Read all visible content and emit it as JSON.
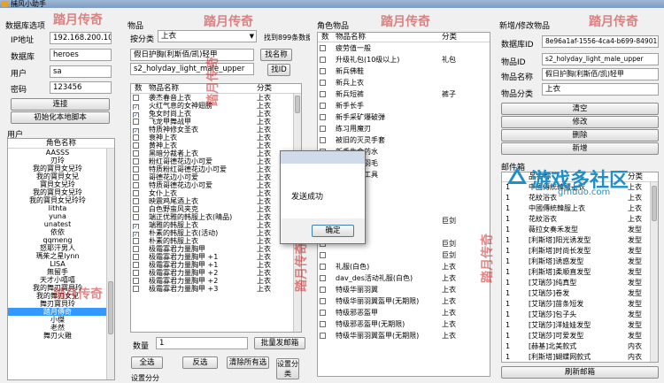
{
  "window": {
    "title": "捕风小助手"
  },
  "db": {
    "group_title": "数据库选项",
    "ip_label": "IP地址",
    "ip_value": "192.168.200.100",
    "db_label": "数据库",
    "db_value": "heroes",
    "user_label": "用户",
    "user_value": "sa",
    "pwd_label": "密码",
    "pwd_value": "123456",
    "connect_button": "连接",
    "init_button": "初始化本地脚本"
  },
  "users": {
    "group_title": "用户",
    "header": "角色名称",
    "items": [
      "AASSS",
      "刃玲",
      "我的寶貝女兒玲",
      "我的寶貝女兒",
      "寶貝女兒玲",
      "我的寶貝女兒玲",
      "我的寶貝女兒玲玲",
      "lithta",
      "yuna",
      "unatest",
      "依依",
      "qqmeng",
      "怒耶汗男人",
      "瑪茱之星lynn",
      "LISA",
      "無留手",
      "天才小嘻嘻",
      "我的舞刃寶貝玲",
      "我的舞刃女兒",
      "舞刃寶貝玲",
      "踏月傳奇",
      "小傑",
      "老然",
      "舞刃火雞"
    ],
    "selected_index": 20
  },
  "items_panel": {
    "group_title": "物品",
    "category_label": "按分类",
    "category_value": "上衣",
    "found_text": "找到899条数据",
    "search_value": "假日护胸(利斯佰/凯)轻甲",
    "search_name_button": "找名称",
    "code_value": "s2_holyday_light_male_upper",
    "search_id_button": "找ID",
    "col_num": "数",
    "col_name": "物品名称",
    "col_cat": "分类",
    "rows": [
      {
        "name": "袭杰春音上衣",
        "cat": "上衣",
        "checked": false
      },
      {
        "name": "火红气息的女神翅膀",
        "cat": "上衣",
        "checked": true
      },
      {
        "name": "兔女时尚上衣",
        "cat": "上衣",
        "checked": true
      },
      {
        "name": "飞龙甲舞战甲",
        "cat": "上衣",
        "checked": false
      },
      {
        "name": "特质神修女圣衣",
        "cat": "上衣",
        "checked": true
      },
      {
        "name": "衰神上衣",
        "cat": "上衣",
        "checked": false
      },
      {
        "name": "黄神上衣",
        "cat": "上衣",
        "checked": false
      },
      {
        "name": "黑暗分裁者上衣",
        "cat": "上衣",
        "checked": false
      },
      {
        "name": "粉红哥德花边小可爱",
        "cat": "上衣",
        "checked": false
      },
      {
        "name": "特质粉红哥德花边小可爱",
        "cat": "上衣",
        "checked": false
      },
      {
        "name": "哥德花边小可爱",
        "cat": "上衣",
        "checked": false
      },
      {
        "name": "特质哥德花边小可爱",
        "cat": "上衣",
        "checked": false
      },
      {
        "name": "女仆上衣",
        "cat": "上衣",
        "checked": false
      },
      {
        "name": "映震鸡尾酒上衣",
        "cat": "上衣",
        "checked": false
      },
      {
        "name": "白色野蛮风夹克",
        "cat": "上衣",
        "checked": false
      },
      {
        "name": "端正优雅的韩服上衣(晴品)",
        "cat": "上衣",
        "checked": false
      },
      {
        "name": "端雅的韩服上衣",
        "cat": "上衣",
        "checked": true
      },
      {
        "name": "朴素的韩服上衣(活动)",
        "cat": "上衣",
        "checked": true
      },
      {
        "name": "朴素的韩服上衣",
        "cat": "上衣",
        "checked": false
      },
      {
        "name": "极霜寡君力量胸甲",
        "cat": "上衣",
        "checked": false
      },
      {
        "name": "极霜寡君力量胸甲 +1",
        "cat": "上衣",
        "checked": false
      },
      {
        "name": "极霜寡君力量胸甲 +1",
        "cat": "上衣",
        "checked": false
      },
      {
        "name": "极霜寡君力量胸甲 +2",
        "cat": "上衣",
        "checked": false
      },
      {
        "name": "极霜寡君力量胸甲 +2",
        "cat": "上衣",
        "checked": false
      },
      {
        "name": "极霜寡君力量胸甲 +3",
        "cat": "上衣",
        "checked": false
      }
    ],
    "qty_label": "数量",
    "qty_value": "1",
    "batch_send_button": "批量发邮箱",
    "select_all_button": "全选",
    "invert_button": "反选",
    "clear_button": "清除所有选",
    "set_category_button": "设置分类",
    "set_text": "设置分分"
  },
  "role_items": {
    "group_title": "角色物品",
    "col_num": "数",
    "col_name": "物品名称",
    "col_cat": "分类",
    "rows": [
      {
        "name": "疲劳值一般",
        "cat": ""
      },
      {
        "name": "升级礼包(10级以上)",
        "cat": "礼包"
      },
      {
        "name": "新兵佛鞋",
        "cat": ""
      },
      {
        "name": "新兵上衣",
        "cat": ""
      },
      {
        "name": "新兵短裤",
        "cat": "裤子"
      },
      {
        "name": "新手长手",
        "cat": ""
      },
      {
        "name": "新手采矿爆破弹",
        "cat": ""
      },
      {
        "name": "练习用魔刃",
        "cat": ""
      },
      {
        "name": "被旧的灭灵手套",
        "cat": ""
      },
      {
        "name": "新手生命药水",
        "cat": ""
      },
      {
        "name": "队友复活羽毛",
        "cat": ""
      },
      {
        "name": "初级修理工具",
        "cat": ""
      },
      {
        "name": "",
        "cat": ""
      },
      {
        "name": "杯限制",
        "cat": ""
      },
      {
        "name": "",
        "cat": ""
      },
      {
        "name": "巨剑",
        "cat": "巨剑"
      },
      {
        "name": "",
        "cat": ""
      },
      {
        "name": "",
        "cat": "巨剑"
      },
      {
        "name": "",
        "cat": "巨剑"
      },
      {
        "name": "礼服(白色)",
        "cat": "上衣"
      },
      {
        "name": "dav_des活动礼服(白色)",
        "cat": "上衣"
      },
      {
        "name": "特级华丽羽翼",
        "cat": "上衣"
      },
      {
        "name": "特级华丽羽翼盔甲(无期限)",
        "cat": "上衣"
      },
      {
        "name": "特级邪恶盔甲",
        "cat": "上衣"
      },
      {
        "name": "特级邪恶盔甲(无期限)",
        "cat": "上衣"
      },
      {
        "name": "特级华丽羽翼盔甲(无期限)",
        "cat": "上衣"
      }
    ]
  },
  "editor": {
    "group_title": "新增/修改物品",
    "dbid_label": "数据库ID",
    "dbid_value": "8e96a1af-1556-4ca4-b699-8490159",
    "itemid_label": "物品ID",
    "itemid_value": "s2_holyday_light_male_upper",
    "itemname_label": "物品名称",
    "itemname_value": "假日护胸(利斯佰/凯)轻甲",
    "itemcat_label": "物品分类",
    "itemcat_value": "上衣",
    "clear_button": "清空",
    "modify_button": "修改",
    "delete_button": "删除",
    "add_button": "新增"
  },
  "mailbox": {
    "group_title": "邮件箱",
    "col_name": "品名称",
    "col_cat": "分类",
    "rows": [
      {
        "num": "1",
        "name": "中國傳統韓服上衣",
        "cat": "上衣"
      },
      {
        "num": "1",
        "name": "花紋浴衣",
        "cat": "上衣"
      },
      {
        "num": "1",
        "name": "中國傳統韓服上衣",
        "cat": "上衣"
      },
      {
        "num": "1",
        "name": "花紋浴衣",
        "cat": "上衣"
      },
      {
        "num": "1",
        "name": "薇拉女奏禾发型",
        "cat": "发型"
      },
      {
        "num": "1",
        "name": "[利斯塔]阳光诱发型",
        "cat": "发型"
      },
      {
        "num": "1",
        "name": "[利斯塔]时尚长发型",
        "cat": "发型"
      },
      {
        "num": "1",
        "name": "[利斯塔]诱惑发型",
        "cat": "发型"
      },
      {
        "num": "1",
        "name": "[利斯塔]柔顺直发型",
        "cat": "发型"
      },
      {
        "num": "1",
        "name": "[艾瑞莎]纯真型",
        "cat": "发型"
      },
      {
        "num": "1",
        "name": "[艾瑞莎]卷发",
        "cat": "发型"
      },
      {
        "num": "1",
        "name": "[艾瑞莎]苗条短发",
        "cat": "发型"
      },
      {
        "num": "1",
        "name": "[艾瑞莎]包子头",
        "cat": "发型"
      },
      {
        "num": "1",
        "name": "[艾瑞莎]洋娃娃发型",
        "cat": "发型"
      },
      {
        "num": "1",
        "name": "[艾瑞莎]可爱发型",
        "cat": "发型"
      },
      {
        "num": "1",
        "name": "[赫基]北美款式",
        "cat": "内衣"
      },
      {
        "num": "1",
        "name": "[利斯塔]蝴蝶网款式",
        "cat": "内衣"
      }
    ],
    "refresh_button": "刷新邮箱"
  },
  "dialog": {
    "message": "发送成功",
    "ok_button": "确定"
  },
  "watermark": {
    "text": "踏月传奇"
  },
  "logo": {
    "main": "游戏多社区",
    "sub": "gmduo.com"
  }
}
